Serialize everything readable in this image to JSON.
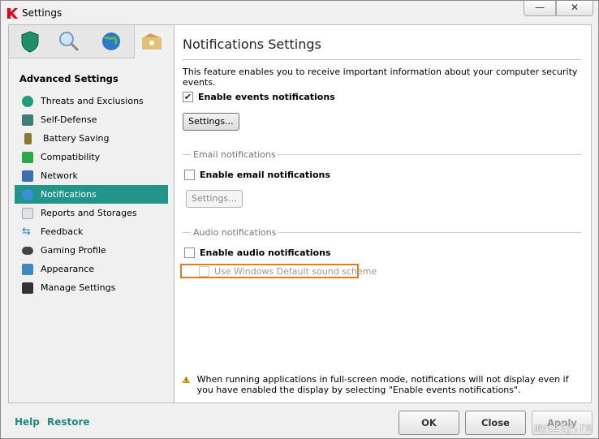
{
  "window": {
    "title": "Settings",
    "minimize": "—",
    "close": "✕"
  },
  "sidebar": {
    "tabs": [
      {
        "icon": "shield-icon"
      },
      {
        "icon": "magnifier-icon"
      },
      {
        "icon": "globe-icon"
      },
      {
        "icon": "settings-box-icon",
        "active": true
      }
    ],
    "heading": "Advanced Settings",
    "items": [
      {
        "label": "Threats and Exclusions",
        "icon": "check-circle-icon",
        "color": "#1f9c7a"
      },
      {
        "label": "Self-Defense",
        "icon": "k-shield-icon",
        "color": "#3f7d76"
      },
      {
        "label": "Battery Saving",
        "icon": "battery-icon",
        "color": "#8a7a30"
      },
      {
        "label": "Compatibility",
        "icon": "check-window-icon",
        "color": "#2aa84a"
      },
      {
        "label": "Network",
        "icon": "network-icon",
        "color": "#3a6fb5"
      },
      {
        "label": "Notifications",
        "icon": "info-icon",
        "color": "#3d8fe0",
        "selected": true
      },
      {
        "label": "Reports and Storages",
        "icon": "report-icon",
        "color": "#b8c0c8"
      },
      {
        "label": "Feedback",
        "icon": "arrows-icon",
        "color": "#2f86d6"
      },
      {
        "label": "Gaming Profile",
        "icon": "gamepad-icon",
        "color": "#444"
      },
      {
        "label": "Appearance",
        "icon": "window-icon",
        "color": "#3a8ac0"
      },
      {
        "label": "Manage Settings",
        "icon": "floppy-icon",
        "color": "#333"
      }
    ]
  },
  "main": {
    "title": "Notifications Settings",
    "description": "This feature enables you to receive important information about your computer security events.",
    "events": {
      "label": "Enable events notifications",
      "checked": true,
      "settings": "Settings..."
    },
    "email": {
      "group": "Email notifications",
      "label": "Enable email notifications",
      "checked": false,
      "settings": "Settings..."
    },
    "audio": {
      "group": "Audio notifications",
      "label": "Enable audio notifications",
      "checked": false,
      "sub": "Use Windows Default sound scheme"
    },
    "warning": "When running applications in full-screen mode, notifications will not display even if you have enabled the display by selecting \"Enable events notifications\"."
  },
  "footer": {
    "help": "Help",
    "restore": "Restore",
    "ok": "OK",
    "close": "Close",
    "apply": "Apply"
  },
  "watermark": "mycity.rs",
  "colors": {
    "accent": "#21958a",
    "highlight": "#e07b1f"
  }
}
